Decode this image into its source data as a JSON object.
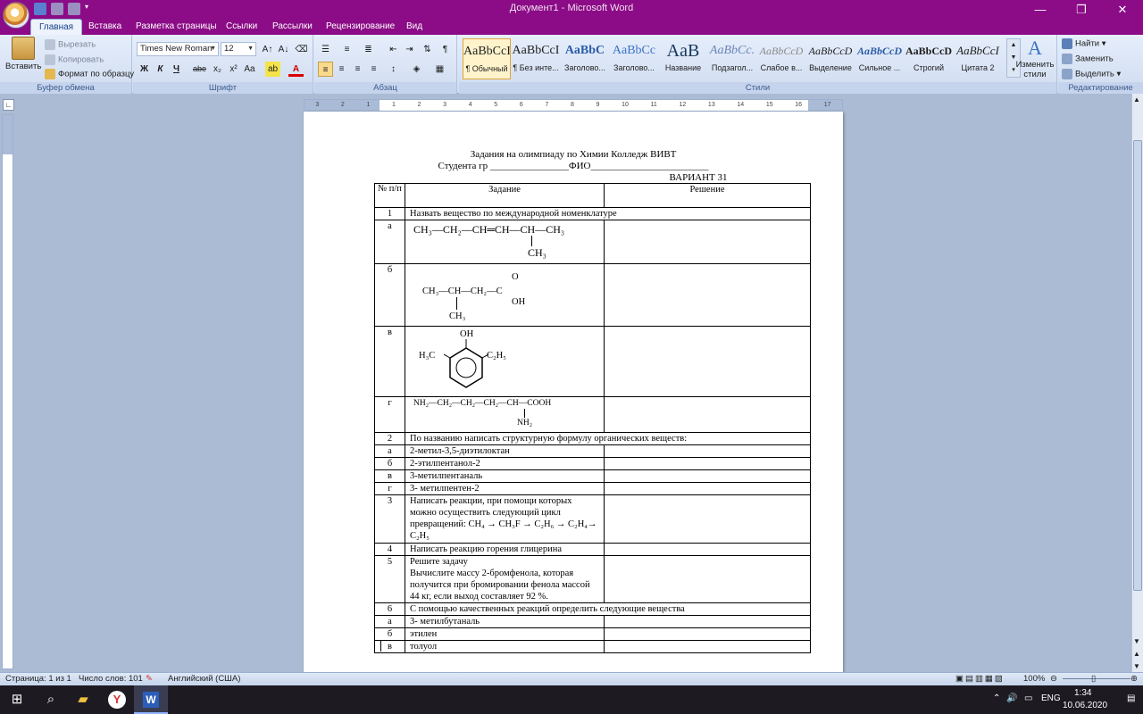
{
  "window": {
    "title": "Документ1 - Microsoft Word",
    "controls": {
      "minimize": "—",
      "maximize": "❐",
      "close": "✕"
    }
  },
  "tabs": [
    "Главная",
    "Вставка",
    "Разметка страницы",
    "Ссылки",
    "Рассылки",
    "Рецензирование",
    "Вид"
  ],
  "active_tab": "Главная",
  "ribbon": {
    "clipboard": {
      "label": "Буфер обмена",
      "paste": "Вставить",
      "cut": "Вырезать",
      "copy": "Копировать",
      "format_painter": "Формат по образцу"
    },
    "font": {
      "label": "Шрифт",
      "font_name": "Times New Roman",
      "font_size": "12",
      "bold": "Ж",
      "italic": "К",
      "underline": "Ч",
      "strike": "abe",
      "subscript": "x₂",
      "superscript": "x²",
      "change_case": "Aa",
      "grow": "A↑",
      "shrink": "A↓"
    },
    "paragraph": {
      "label": "Абзац"
    },
    "styles": {
      "label": "Стили",
      "items": [
        {
          "sample": "AaBbCcI",
          "name": "¶ Обычный"
        },
        {
          "sample": "AaBbCcI",
          "name": "¶ Без инте..."
        },
        {
          "sample": "AaBbC",
          "name": "Заголово..."
        },
        {
          "sample": "AaBbCc",
          "name": "Заголово..."
        },
        {
          "sample": "AaB",
          "name": "Название"
        },
        {
          "sample": "AaBbCc.",
          "name": "Подзагол..."
        },
        {
          "sample": "AaBbCcD",
          "name": "Слабое в..."
        },
        {
          "sample": "AaBbCcD",
          "name": "Выделение"
        },
        {
          "sample": "AaBbCcD",
          "name": "Сильное ..."
        },
        {
          "sample": "AaBbCcD",
          "name": "Строгий"
        },
        {
          "sample": "AaBbCcI",
          "name": "Цитата 2"
        }
      ],
      "change_styles": "Изменить стили"
    },
    "editing": {
      "label": "Редактирование",
      "find": "Найти",
      "replace": "Заменить",
      "select": "Выделить"
    }
  },
  "ruler_numbers": [
    "3",
    "2",
    "1",
    "1",
    "2",
    "3",
    "4",
    "5",
    "6",
    "7",
    "8",
    "9",
    "10",
    "11",
    "12",
    "13",
    "14",
    "15",
    "16",
    "17"
  ],
  "document": {
    "title": "Задания на олимпиаду по Химии Колледж ВИВТ",
    "student_line": "Студента гр ________________ФИО________________________",
    "variant": "ВАРИАНТ 31",
    "headers": {
      "num": "№ п/п",
      "task": "Задание",
      "solution": "Решение"
    },
    "rows": [
      {
        "num": "1",
        "task": "Назвать вещество по международной номенклатуре"
      },
      {
        "num": "а",
        "formula": "CH₃—CH₂—CH═CH—CH—CH₃",
        "branch": "CH₃"
      },
      {
        "num": "б",
        "formula": "CH₃—CH—CH₂—C",
        "acid_o": "O",
        "acid_oh": "OH",
        "branch": "CH₃"
      },
      {
        "num": "в",
        "oh": "OH",
        "left": "H₃C",
        "right": "C₂H₅"
      },
      {
        "num": "г",
        "formula": "NH₂—CH₂—CH₂—CH₂—CH—COOH",
        "branch": "NH₂"
      },
      {
        "num": "2",
        "task": "По названию написать структурную формулу органических веществ:"
      },
      {
        "num": "а",
        "task": "2-метил-3,5-диэтилоктан"
      },
      {
        "num": "б",
        "task": "2-этилпентанол-2"
      },
      {
        "num": "в",
        "task": "3-метилпентаналь"
      },
      {
        "num": "г",
        "task": "3- метилпентен-2"
      },
      {
        "num": "3",
        "task": "Написать реакции, при помощи которых можно осуществить следующий цикл превращений: CH₄ → CH₃F → C₂H₆ → C₂H₄→ C₂H₅"
      },
      {
        "num": "4",
        "task": "Написать реакцию горения глицерина"
      },
      {
        "num": "5",
        "task": "Решите задачу",
        "task2": "Вычислите массу 2-бромфенола, которая получится при бромировании фенола массой 44 кг, если выход составляет 92 %."
      },
      {
        "num": "6",
        "task": "С помощью качественных реакций определить следующие вещества"
      },
      {
        "num": "а",
        "task": "3- метилбутаналь"
      },
      {
        "num": "б",
        "task": "этилен"
      },
      {
        "num": "в",
        "task": "толуол"
      }
    ]
  },
  "statusbar": {
    "page": "Страница: 1 из 1",
    "words": "Число слов: 101",
    "language": "Английский (США)",
    "zoom": "100%"
  },
  "taskbar": {
    "lang": "ENG",
    "time": "1:34",
    "date": "10.06.2020"
  },
  "colors": {
    "titlebar": "#8b0c86",
    "ribbon_bg": "#dfe8f6",
    "workspace": "#abbbd3",
    "taskbar": "#1d1a22"
  }
}
